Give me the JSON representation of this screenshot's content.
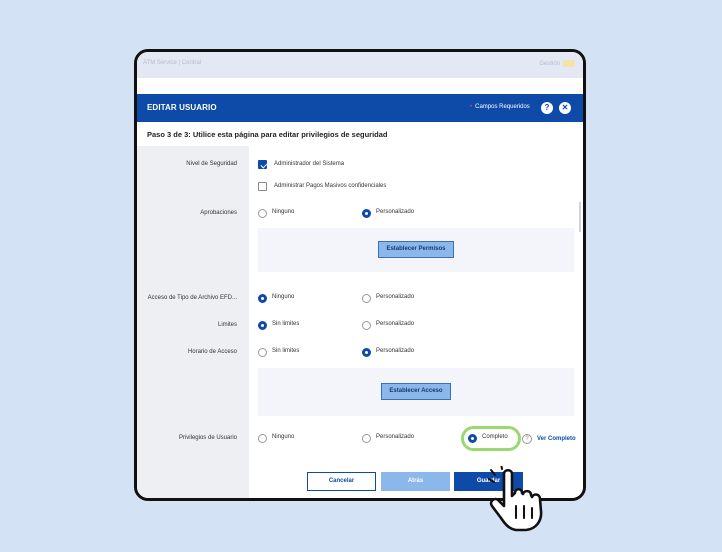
{
  "topbar": {
    "left_text": "ATM Service | Central",
    "right_text": "Gestión"
  },
  "header": {
    "title": "EDITAR USUARIO",
    "required_label": "Campos Requeridos",
    "help_glyph": "?",
    "close_glyph": "✕"
  },
  "step_text": "Paso 3 de 3:  Utilice esta página para editar privilegios de seguridad",
  "fields": {
    "security_level": {
      "label": "Nivel de Seguridad",
      "options": [
        {
          "label": "Administrador del Sistema",
          "checked": true
        },
        {
          "label": "Administrar Pagos Masivos confidenciales",
          "checked": false
        }
      ]
    },
    "approvals": {
      "label": "Aprobaciones",
      "options": [
        {
          "label": "Ninguno",
          "selected": false
        },
        {
          "label": "Personalizado",
          "selected": true
        }
      ],
      "button": "Establecer Permisos"
    },
    "file_type_access": {
      "label": "Acceso de Tipo de Archivo EFD...",
      "options": [
        {
          "label": "Ninguno",
          "selected": true
        },
        {
          "label": "Personalizado",
          "selected": false
        }
      ]
    },
    "limits": {
      "label": "Limites",
      "options": [
        {
          "label": "Sin limites",
          "selected": true
        },
        {
          "label": "Personalizado",
          "selected": false
        }
      ]
    },
    "access_schedule": {
      "label": "Horario de Acceso",
      "options": [
        {
          "label": "Sin limites",
          "selected": false
        },
        {
          "label": "Personalizado",
          "selected": true
        }
      ],
      "button": "Establecer Acceso"
    },
    "user_privileges": {
      "label": "Privilegios de Usuario",
      "options": [
        {
          "label": "Ninguno",
          "selected": false
        },
        {
          "label": "Personalizado",
          "selected": false
        },
        {
          "label": "Completo",
          "selected": true
        }
      ],
      "help_glyph": "?",
      "link": "Ver Completo"
    }
  },
  "footer": {
    "cancel": "Cancelar",
    "back": "Atrás",
    "save": "Guardar"
  },
  "colors": {
    "primary": "#0e4ba9",
    "light_button": "#8cb7ea",
    "highlight": "#9bd86f",
    "background": "#d3e3f5"
  }
}
